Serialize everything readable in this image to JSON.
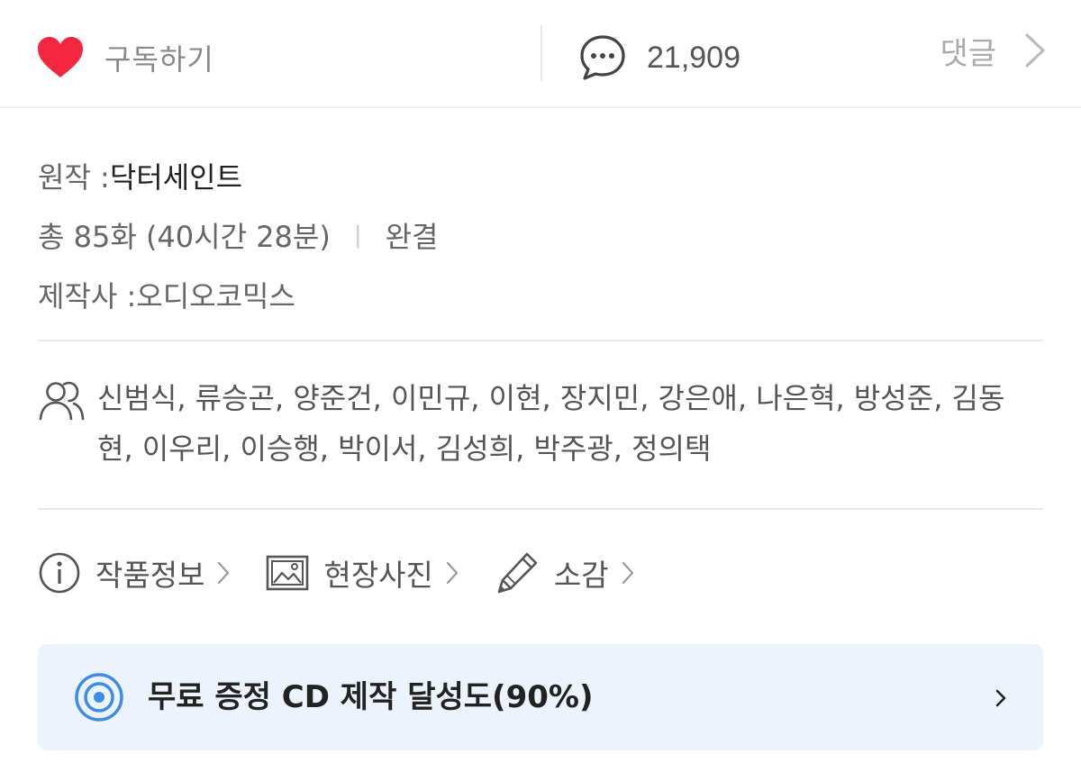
{
  "top_bar": {
    "subscribe_label": "구독하기",
    "comment_count": "21,909",
    "comment_link_label": "댓글",
    "icons": {
      "subscribe": "heart-icon",
      "comments": "speech-bubble-icon",
      "more": "chevron-right-icon"
    },
    "heart_color": "#F5273F"
  },
  "info": {
    "original_key": "원작 : ",
    "original_value": "닥터세인트",
    "episodes_text": "총 85화 (40시간 28분)",
    "separator": "|",
    "status": "완결",
    "producer_key": "제작사 : ",
    "producer_value": "오디오코믹스"
  },
  "cast": {
    "icon": "people-icon",
    "names": "신범식, 류승곤, 양준건, 이민규, 이현, 장지민, 강은애, 나은혁, 방성준, 김동현, 이우리, 이승행, 박이서, 김성희, 박주광, 정의택"
  },
  "links": [
    {
      "label": "작품정보",
      "icon": "info-icon"
    },
    {
      "label": "현장사진",
      "icon": "image-icon"
    },
    {
      "label": "소감",
      "icon": "pencil-icon"
    }
  ],
  "banner": {
    "text": "무료 증정 CD 제작 달성도(90%)",
    "progress_percent": 90,
    "icon": "target-icon",
    "accent_color": "#3D8BEB",
    "background_color": "#EDF3FD"
  }
}
